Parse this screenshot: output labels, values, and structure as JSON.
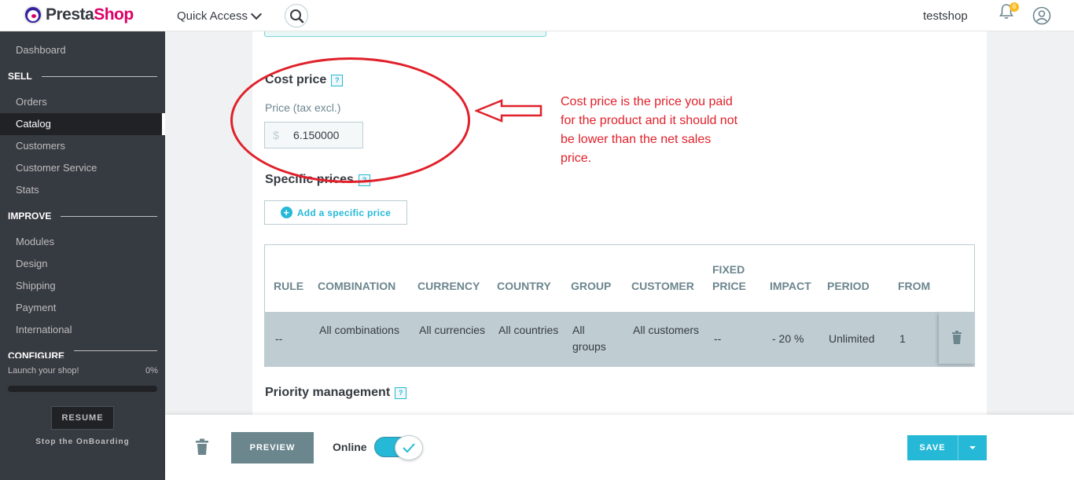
{
  "header": {
    "logo": "PrestaShop",
    "quick_access": "Quick Access",
    "shop_name": "testshop",
    "notifications_count": "6"
  },
  "sidebar": {
    "dashboard": "Dashboard",
    "sections": {
      "sell": "SELL",
      "improve": "IMPROVE",
      "configure": "CONFIGURE"
    },
    "sell_items": [
      "Orders",
      "Catalog",
      "Customers",
      "Customer Service",
      "Stats"
    ],
    "improve_items": [
      "Modules",
      "Design",
      "Shipping",
      "Payment",
      "International"
    ],
    "active_item": "Catalog",
    "onboarding": {
      "label": "Launch your shop!",
      "percent": "0%",
      "progress": 0,
      "resume": "RESUME",
      "stop": "Stop the OnBoarding"
    }
  },
  "cost_price": {
    "title": "Cost price",
    "help": "?",
    "field_label": "Price (tax excl.)",
    "currency": "$",
    "value": "6.150000"
  },
  "specific_prices": {
    "title": "Specific prices",
    "help": "?",
    "add_button": "Add a specific price",
    "columns": [
      "RULE",
      "COMBINATION",
      "CURRENCY",
      "COUNTRY",
      "GROUP",
      "CUSTOMER",
      "FIXED PRICE",
      "IMPACT",
      "PERIOD",
      "FROM"
    ],
    "rows": [
      {
        "rule": "--",
        "combination": "All combinations",
        "currency": "All currencies",
        "country": "All countries",
        "group": "All groups",
        "customer": "All customers",
        "fixed_price": "--",
        "impact": "- 20 %",
        "period": "Unlimited",
        "from": "1"
      }
    ]
  },
  "priority": {
    "title": "Priority management",
    "help": "?"
  },
  "annotation": {
    "text": "Cost price is the price you paid for the product and it should not be lower than the net sales price.",
    "color": "#e0202a"
  },
  "footer": {
    "preview": "PREVIEW",
    "online": "Online",
    "online_enabled": true,
    "save": "SAVE"
  },
  "colors": {
    "accent": "#25b9d7",
    "sidebar_bg": "#363a41",
    "brand_pink": "#df0067"
  }
}
